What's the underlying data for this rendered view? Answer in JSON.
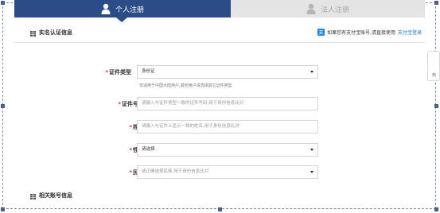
{
  "tabs": {
    "personal_label": "个人注册",
    "company_label": "法人注册"
  },
  "section_realname": {
    "title": "实名认证信息",
    "alipay_note": "如果您有支付宝账号,请直接使用",
    "alipay_link": "支付宝登录",
    "alipay_icon_glyph": "支"
  },
  "form": {
    "id_type": {
      "label": "证件类型",
      "value": "身份证",
      "hint": "仅适用于中国大陆用户,其他用户请选择其它证件类型"
    },
    "id_number": {
      "label": "证件号码",
      "placeholder": "请输入与证件类型一致的证件号码,用于身份信息比对"
    },
    "name": {
      "label": "姓名",
      "placeholder": "请输入与证件上显示一致的姓名,用于身份信息比对"
    },
    "gender": {
      "label": "性别",
      "value": "请选择"
    },
    "ethnicity": {
      "label": "民族",
      "placeholder": "请正确选择民族,用于身份信息比对"
    }
  },
  "section_account": {
    "title": "相关账号信息"
  },
  "side_widget": {
    "text": "热"
  },
  "colors": {
    "tab_active": "#2b4c86",
    "tab_inactive": "#e4e4e4",
    "required_star": "#d0342c",
    "link": "#1976d2"
  }
}
